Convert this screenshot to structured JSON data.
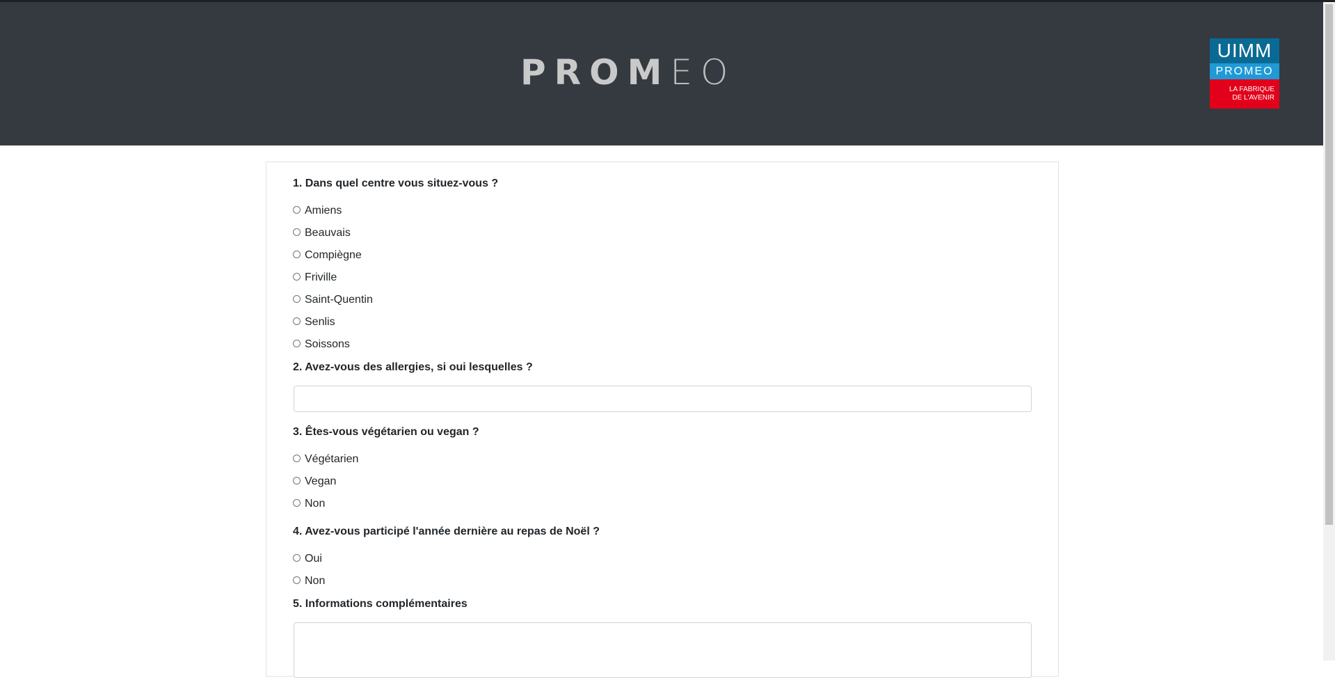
{
  "header": {
    "brand_bold": "PROM",
    "brand_light": "EO",
    "logo": {
      "top": "UIMM",
      "mid": "PROMEO",
      "bottom_line1": "LA FABRIQUE",
      "bottom_line2": "DE L'AVENIR"
    }
  },
  "form": {
    "q1": {
      "label": "1. Dans quel centre vous situez-vous ?",
      "options": [
        "Amiens",
        "Beauvais",
        "Compiègne",
        "Friville",
        "Saint-Quentin",
        "Senlis",
        "Soissons"
      ]
    },
    "q2": {
      "label": "2. Avez-vous des allergies, si oui lesquelles ?",
      "value": ""
    },
    "q3": {
      "label": "3. Êtes-vous végétarien ou vegan ?",
      "options": [
        "Végétarien",
        "Vegan",
        "Non"
      ]
    },
    "q4": {
      "label": "4. Avez-vous participé l'année dernière au repas de Noël ?",
      "options": [
        "Oui",
        "Non"
      ]
    },
    "q5": {
      "label": "5. Informations complémentaires",
      "value": ""
    }
  },
  "colors": {
    "header_bg": "#343a40",
    "logo_blue": "#0b6a94",
    "logo_light_blue": "#1e9ad6",
    "logo_red": "#e2001a"
  }
}
